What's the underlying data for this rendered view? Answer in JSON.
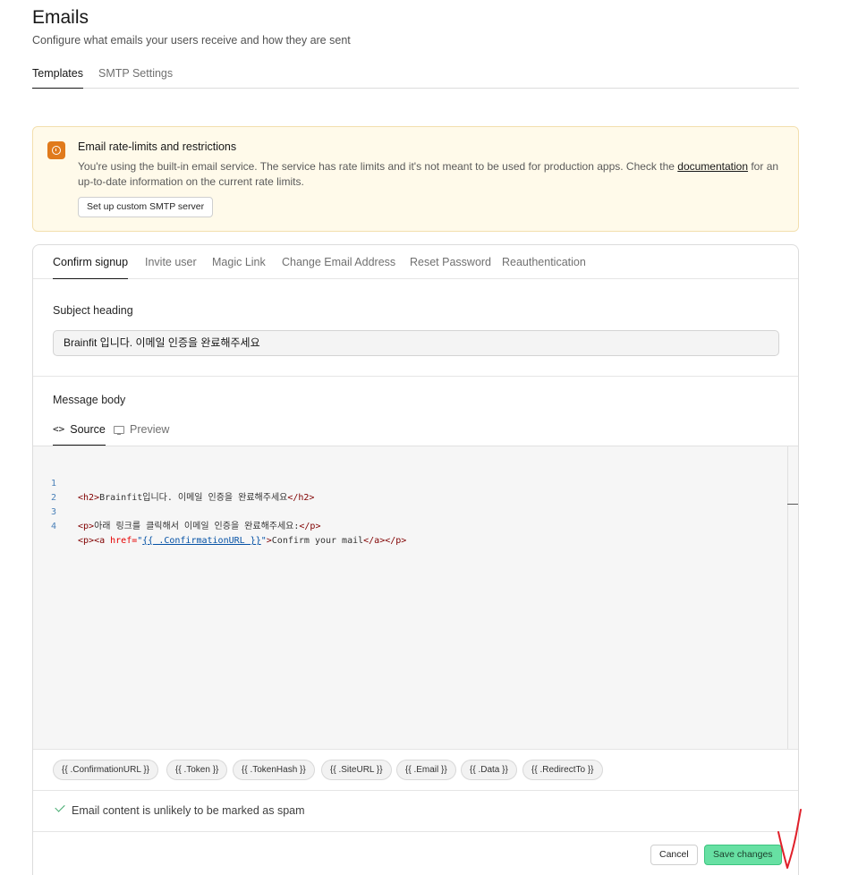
{
  "page": {
    "title": "Emails",
    "subtitle": "Configure what emails your users receive and how they are sent"
  },
  "top_tabs": [
    {
      "label": "Templates",
      "active": true
    },
    {
      "label": "SMTP Settings",
      "active": false
    }
  ],
  "warning": {
    "title": "Email rate-limits and restrictions",
    "text_before": "You're using the built-in email service. The service has rate limits and it's not meant to be used for production apps. Check the ",
    "link": "documentation",
    "text_after": " for an up-to-date information on the current rate limits.",
    "button": "Set up custom SMTP server",
    "accent_color": "#e07a1c"
  },
  "template_tabs": [
    {
      "label": "Confirm signup",
      "active": true
    },
    {
      "label": "Invite user",
      "active": false
    },
    {
      "label": "Magic Link",
      "active": false
    },
    {
      "label": "Change Email Address",
      "active": false
    },
    {
      "label": "Reset Password",
      "active": false
    },
    {
      "label": "Reauthentication",
      "active": false
    }
  ],
  "subject": {
    "label": "Subject heading",
    "value": "Brainfit 입니다. 이메일 인증을 완료해주세요"
  },
  "message_body": {
    "label": "Message body",
    "source_tab": "Source",
    "preview_tab": "Preview",
    "source_icon": "code-brackets-icon",
    "preview_icon": "monitor-icon",
    "code_lines": [
      {
        "num": "1",
        "tag_open": "<h2>",
        "text": "Brainfit입니다. 이메일 인증을 완료해주세요",
        "tag_close": "</h2>"
      },
      {
        "num": "2"
      },
      {
        "num": "3",
        "tag_open": "<p>",
        "text": "아래 링크를 클릭해서 이메일 인증을 완료해주세요:",
        "tag_close": "</p>"
      },
      {
        "num": "4",
        "p_open": "<p>",
        "a_open": "<a",
        "attr": " href=",
        "quote_open": "\"",
        "url": "{{ .ConfirmationURL }}",
        "quote_close": "\"",
        "a_end": ">",
        "link_text": "Confirm your mail",
        "a_close": "</a>",
        "p_close": "</p>"
      }
    ]
  },
  "variables": [
    "{{ .ConfirmationURL }}",
    "{{ .Token }}",
    "{{ .TokenHash }}",
    "{{ .SiteURL }}",
    "{{ .Email }}",
    "{{ .Data }}",
    "{{ .RedirectTo }}"
  ],
  "spam_check": {
    "icon": "check-icon",
    "text": "Email content is unlikely to be marked as spam",
    "color": "#3ea86a"
  },
  "footer": {
    "cancel": "Cancel",
    "save": "Save changes",
    "save_color": "#67e0a3"
  },
  "annotation_color": "#e0202a"
}
